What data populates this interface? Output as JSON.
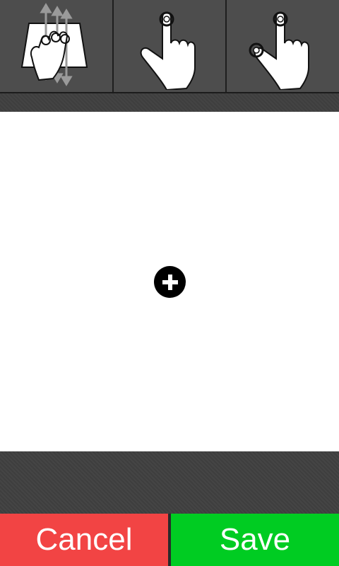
{
  "toolbar": {
    "tools": [
      {
        "icon": "three-finger-swipe-icon"
      },
      {
        "icon": "single-finger-tap-icon"
      },
      {
        "icon": "two-finger-tap-icon"
      }
    ]
  },
  "canvas": {
    "add_icon": "plus-circle-icon"
  },
  "actions": {
    "cancel_label": "Cancel",
    "save_label": "Save"
  },
  "colors": {
    "cancel": "#f24444",
    "save": "#00cc22",
    "toolbar": "#4d4d4d"
  }
}
